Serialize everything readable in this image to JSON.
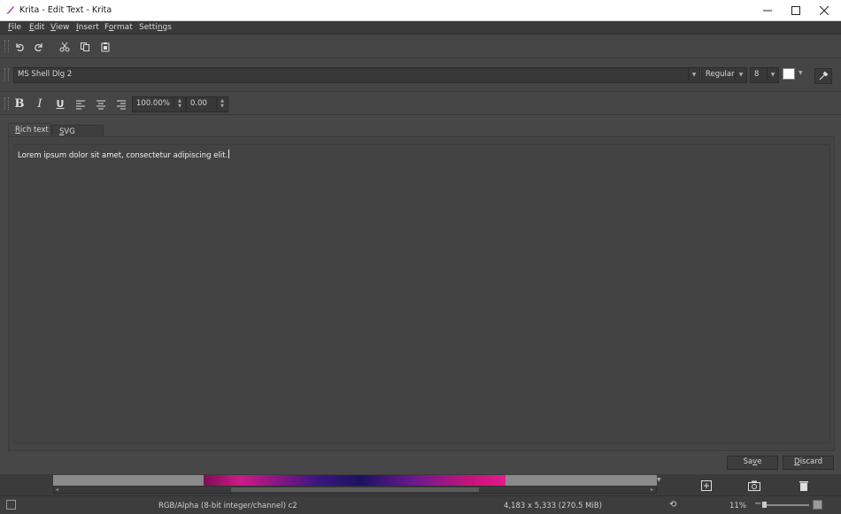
{
  "window": {
    "title": "Krita - Edit Text - Krita"
  },
  "menu": [
    {
      "label": "File",
      "accel": "F",
      "rest": "ile"
    },
    {
      "label": "Edit",
      "accel": "E",
      "rest": "dit"
    },
    {
      "label": "View",
      "accel": "V",
      "rest": "iew"
    },
    {
      "label": "Insert",
      "accel": "I",
      "rest": "nsert"
    },
    {
      "label": "Format",
      "pre": "F",
      "accel": "o",
      "rest": "rmat"
    },
    {
      "label": "Settings",
      "pre": "Setti",
      "accel": "n",
      "rest": "gs"
    }
  ],
  "font_toolbar": {
    "font_family": "MS Shell Dlg 2",
    "font_style": "Regular",
    "font_size": "8",
    "color": "#ffffff"
  },
  "format_toolbar": {
    "line_height": "100.00%",
    "letter_spacing": "0.00"
  },
  "tabs": [
    {
      "label": "Rich text",
      "accel": "R",
      "rest": "ich text"
    },
    {
      "label": "SVG Source",
      "accel": "S",
      "rest": "VG Source"
    }
  ],
  "editor": {
    "text": "Lorem ipsum dolor sit amet, consectetur adipiscing elit."
  },
  "buttons": {
    "save": {
      "pre": "Sa",
      "accel": "v",
      "rest": "e"
    },
    "discard": {
      "accel": "D",
      "rest": "iscard"
    }
  },
  "statusbar": {
    "color_space": "RGB/Alpha (8-bit integer/channel)  c2",
    "image_size": "4,183 x 5,333 (270.5 MiB)",
    "zoom": "11%"
  },
  "icons": [
    "krita-icon",
    "undo-icon",
    "redo-icon",
    "cut-icon",
    "copy-icon",
    "paste-icon",
    "eyedropper-icon",
    "bold-icon",
    "italic-icon",
    "underline-icon",
    "align-left-icon",
    "align-center-icon",
    "align-right-icon",
    "add-layer-icon",
    "snapshot-icon",
    "trash-icon",
    "rotation-icon"
  ]
}
